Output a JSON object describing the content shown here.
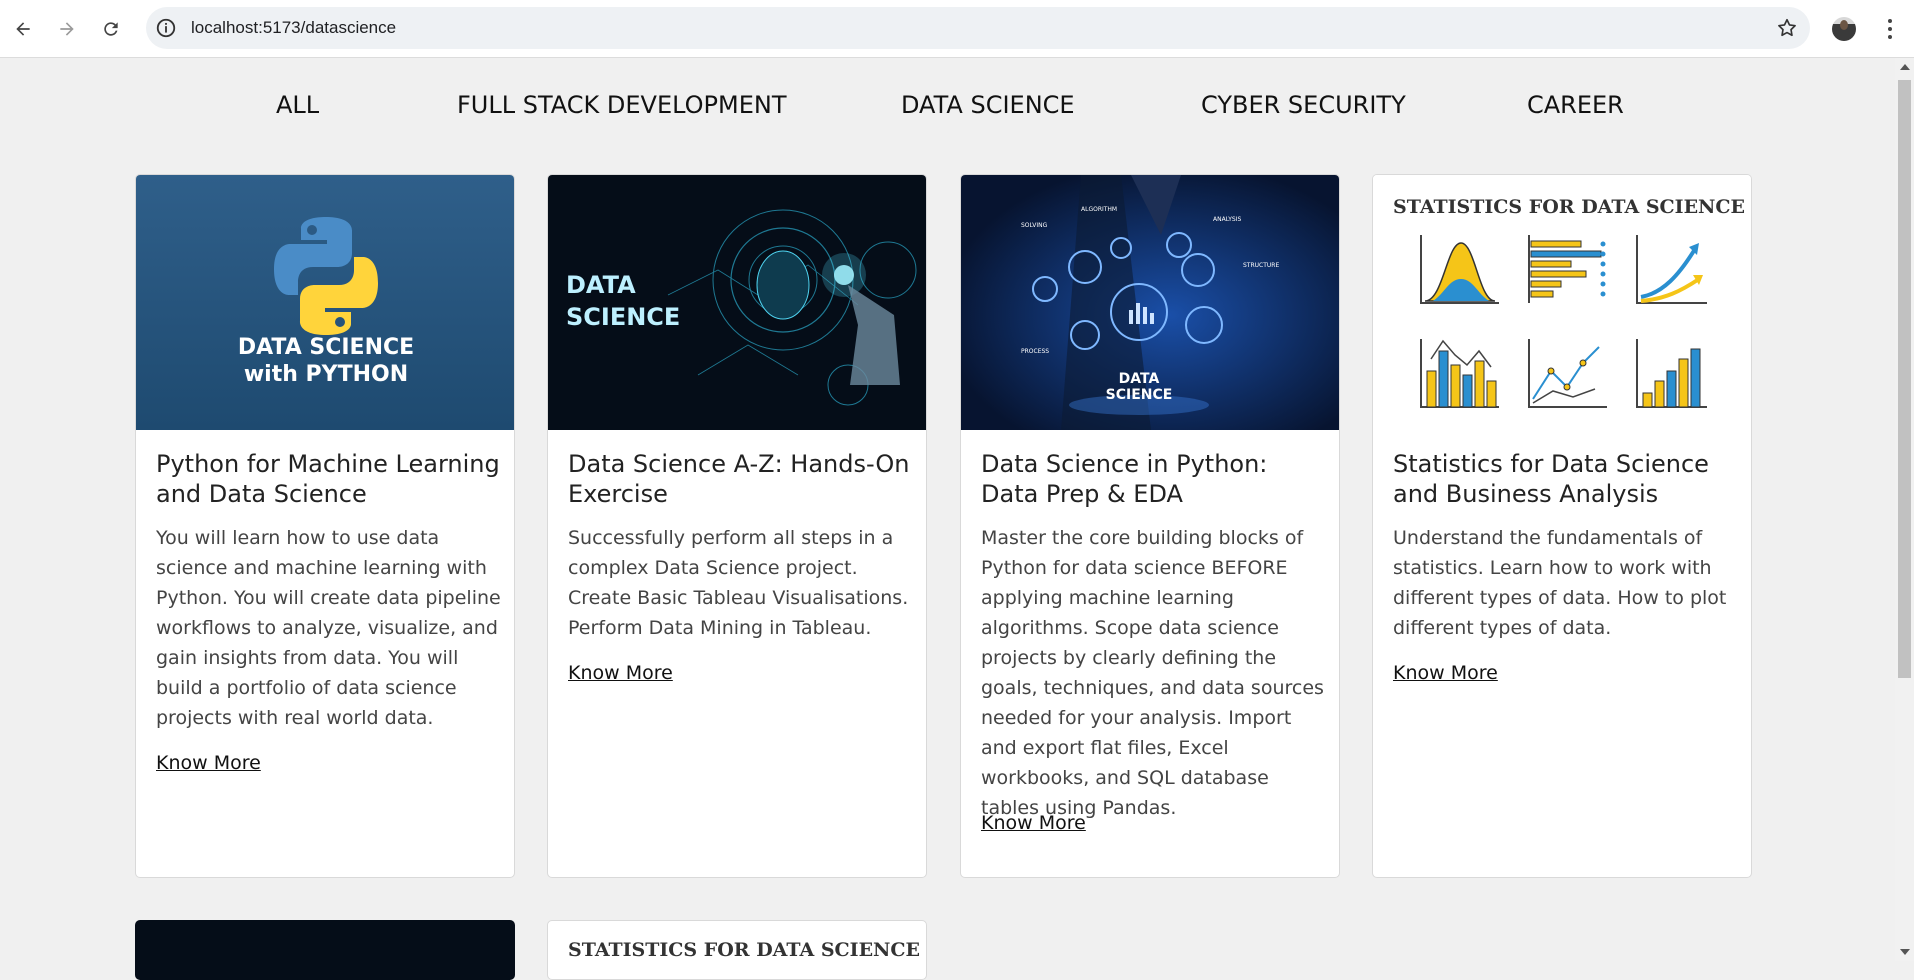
{
  "browser": {
    "url": "localhost:5173/datascience"
  },
  "categories": [
    "ALL",
    "FULL STACK DEVELOPMENT",
    "DATA SCIENCE",
    "CYBER SECURITY",
    "CAREER"
  ],
  "courses": [
    {
      "image_line1": "DATA SCIENCE",
      "image_line2": "with PYTHON",
      "title": "Python for Machine Learning and Data Science",
      "description": "You will learn how to use data science and machine learning with Python. You will create data pipeline workflows to analyze, visualize, and gain insights from data. You will build a portfolio of data science projects with real world data.",
      "link": "Know More"
    },
    {
      "image_line1": "DATA",
      "image_line2": "SCIENCE",
      "title": "Data Science A-Z: Hands-On Exercise",
      "description": "Successfully perform all steps in a complex Data Science project. Create Basic Tableau Visualisations. Perform Data Mining in Tableau.",
      "link": "Know More"
    },
    {
      "image_line1": "DATA",
      "image_line2": "SCIENCE",
      "image_labels": [
        "SOLVING",
        "ALGORITHM",
        "ANALYSIS",
        "STRUCTURE",
        "PROCESS"
      ],
      "title": "Data Science in Python: Data Prep & EDA",
      "description": "Master the core building blocks of Python for data science BEFORE applying machine learning algorithms. Scope data science projects by clearly defining the goals, techniques, and data sources needed for your analysis. Import and export flat files, Excel workbooks, and SQL database tables using Pandas.",
      "link": "Know More"
    },
    {
      "image_line1": "STATISTICS FOR DATA SCIENCE",
      "title": "Statistics for Data Science and Business Analysis",
      "description": "Understand the fundamentals of statistics. Learn how to work with different types of data. How to plot different types of data.",
      "link": "Know More"
    }
  ],
  "second_row": {
    "card2_header": "STATISTICS FOR DATA SCIENCE"
  },
  "colors": {
    "page_bg": "#f0f0f0",
    "card_bg": "#ffffff",
    "python_blue": "#2f5f8a",
    "dark_navy": "#061423",
    "chart_yellow": "#f5c518",
    "chart_blue": "#2a8fd0"
  }
}
